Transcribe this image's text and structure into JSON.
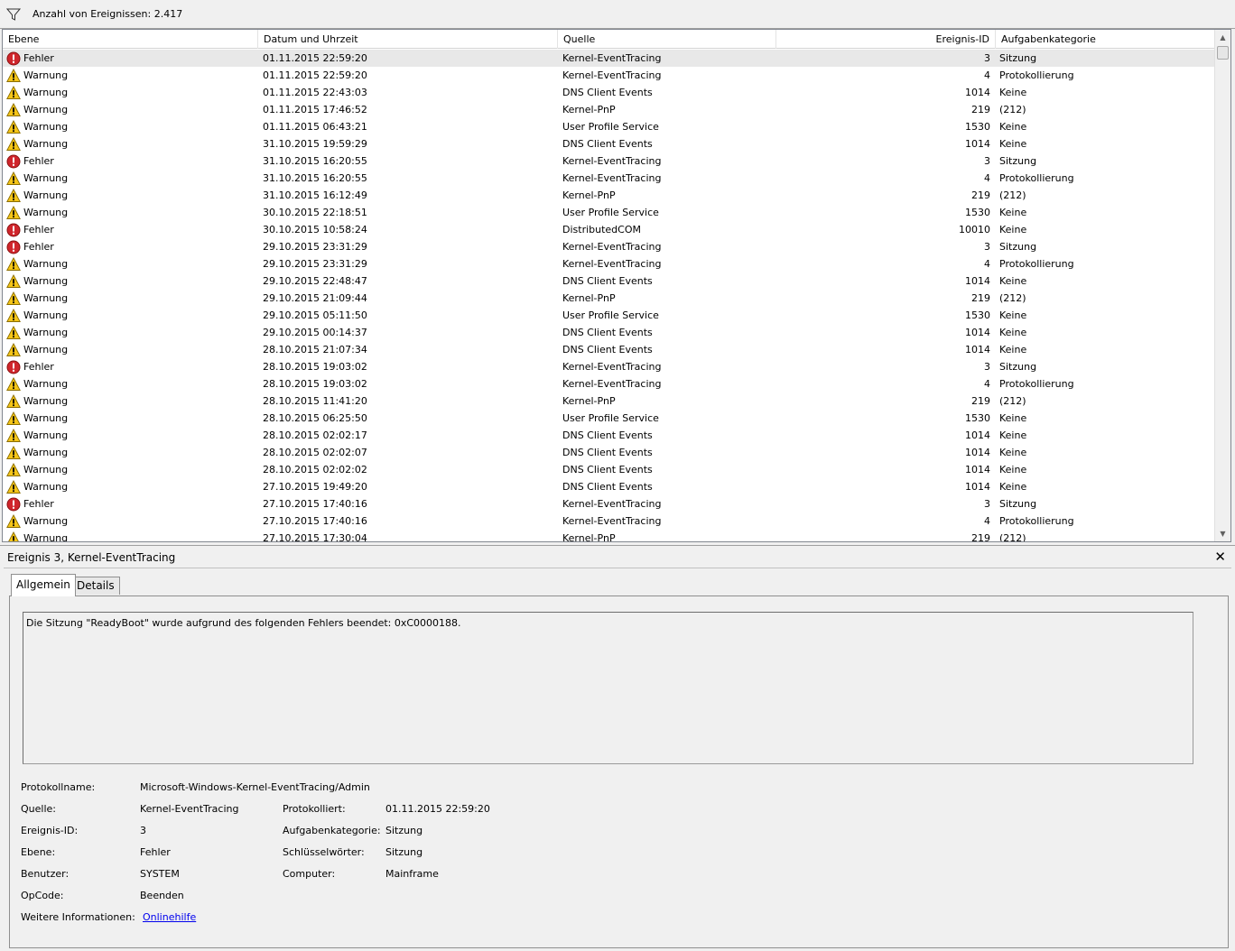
{
  "filter": {
    "event_count": "Anzahl von Ereignissen: 2.417"
  },
  "columns": {
    "level": "Ebene",
    "datetime": "Datum und Uhrzeit",
    "source": "Quelle",
    "event_id": "Ereignis-ID",
    "category": "Aufgabenkategorie"
  },
  "events": [
    {
      "level": "Fehler",
      "type": "error",
      "datetime": "01.11.2015 22:59:20",
      "source": "Kernel-EventTracing",
      "id": "3",
      "category": "Sitzung"
    },
    {
      "level": "Warnung",
      "type": "warning",
      "datetime": "01.11.2015 22:59:20",
      "source": "Kernel-EventTracing",
      "id": "4",
      "category": "Protokollierung"
    },
    {
      "level": "Warnung",
      "type": "warning",
      "datetime": "01.11.2015 22:43:03",
      "source": "DNS Client Events",
      "id": "1014",
      "category": "Keine"
    },
    {
      "level": "Warnung",
      "type": "warning",
      "datetime": "01.11.2015 17:46:52",
      "source": "Kernel-PnP",
      "id": "219",
      "category": "(212)"
    },
    {
      "level": "Warnung",
      "type": "warning",
      "datetime": "01.11.2015 06:43:21",
      "source": "User Profile Service",
      "id": "1530",
      "category": "Keine"
    },
    {
      "level": "Warnung",
      "type": "warning",
      "datetime": "31.10.2015 19:59:29",
      "source": "DNS Client Events",
      "id": "1014",
      "category": "Keine"
    },
    {
      "level": "Fehler",
      "type": "error",
      "datetime": "31.10.2015 16:20:55",
      "source": "Kernel-EventTracing",
      "id": "3",
      "category": "Sitzung"
    },
    {
      "level": "Warnung",
      "type": "warning",
      "datetime": "31.10.2015 16:20:55",
      "source": "Kernel-EventTracing",
      "id": "4",
      "category": "Protokollierung"
    },
    {
      "level": "Warnung",
      "type": "warning",
      "datetime": "31.10.2015 16:12:49",
      "source": "Kernel-PnP",
      "id": "219",
      "category": "(212)"
    },
    {
      "level": "Warnung",
      "type": "warning",
      "datetime": "30.10.2015 22:18:51",
      "source": "User Profile Service",
      "id": "1530",
      "category": "Keine"
    },
    {
      "level": "Fehler",
      "type": "error",
      "datetime": "30.10.2015 10:58:24",
      "source": "DistributedCOM",
      "id": "10010",
      "category": "Keine"
    },
    {
      "level": "Fehler",
      "type": "error",
      "datetime": "29.10.2015 23:31:29",
      "source": "Kernel-EventTracing",
      "id": "3",
      "category": "Sitzung"
    },
    {
      "level": "Warnung",
      "type": "warning",
      "datetime": "29.10.2015 23:31:29",
      "source": "Kernel-EventTracing",
      "id": "4",
      "category": "Protokollierung"
    },
    {
      "level": "Warnung",
      "type": "warning",
      "datetime": "29.10.2015 22:48:47",
      "source": "DNS Client Events",
      "id": "1014",
      "category": "Keine"
    },
    {
      "level": "Warnung",
      "type": "warning",
      "datetime": "29.10.2015 21:09:44",
      "source": "Kernel-PnP",
      "id": "219",
      "category": "(212)"
    },
    {
      "level": "Warnung",
      "type": "warning",
      "datetime": "29.10.2015 05:11:50",
      "source": "User Profile Service",
      "id": "1530",
      "category": "Keine"
    },
    {
      "level": "Warnung",
      "type": "warning",
      "datetime": "29.10.2015 00:14:37",
      "source": "DNS Client Events",
      "id": "1014",
      "category": "Keine"
    },
    {
      "level": "Warnung",
      "type": "warning",
      "datetime": "28.10.2015 21:07:34",
      "source": "DNS Client Events",
      "id": "1014",
      "category": "Keine"
    },
    {
      "level": "Fehler",
      "type": "error",
      "datetime": "28.10.2015 19:03:02",
      "source": "Kernel-EventTracing",
      "id": "3",
      "category": "Sitzung"
    },
    {
      "level": "Warnung",
      "type": "warning",
      "datetime": "28.10.2015 19:03:02",
      "source": "Kernel-EventTracing",
      "id": "4",
      "category": "Protokollierung"
    },
    {
      "level": "Warnung",
      "type": "warning",
      "datetime": "28.10.2015 11:41:20",
      "source": "Kernel-PnP",
      "id": "219",
      "category": "(212)"
    },
    {
      "level": "Warnung",
      "type": "warning",
      "datetime": "28.10.2015 06:25:50",
      "source": "User Profile Service",
      "id": "1530",
      "category": "Keine"
    },
    {
      "level": "Warnung",
      "type": "warning",
      "datetime": "28.10.2015 02:02:17",
      "source": "DNS Client Events",
      "id": "1014",
      "category": "Keine"
    },
    {
      "level": "Warnung",
      "type": "warning",
      "datetime": "28.10.2015 02:02:07",
      "source": "DNS Client Events",
      "id": "1014",
      "category": "Keine"
    },
    {
      "level": "Warnung",
      "type": "warning",
      "datetime": "28.10.2015 02:02:02",
      "source": "DNS Client Events",
      "id": "1014",
      "category": "Keine"
    },
    {
      "level": "Warnung",
      "type": "warning",
      "datetime": "27.10.2015 19:49:20",
      "source": "DNS Client Events",
      "id": "1014",
      "category": "Keine"
    },
    {
      "level": "Fehler",
      "type": "error",
      "datetime": "27.10.2015 17:40:16",
      "source": "Kernel-EventTracing",
      "id": "3",
      "category": "Sitzung"
    },
    {
      "level": "Warnung",
      "type": "warning",
      "datetime": "27.10.2015 17:40:16",
      "source": "Kernel-EventTracing",
      "id": "4",
      "category": "Protokollierung"
    },
    {
      "level": "Warnung",
      "type": "warning",
      "datetime": "27.10.2015 17:30:04",
      "source": "Kernel-PnP",
      "id": "219",
      "category": "(212)"
    }
  ],
  "detail": {
    "title": "Ereignis 3, Kernel-EventTracing",
    "tabs": [
      "Allgemein",
      "Details"
    ],
    "message": "Die Sitzung \"ReadyBoot\" wurde aufgrund des folgenden Fehlers beendet: 0xC0000188.",
    "labels": {
      "log_name": "Protokollname:",
      "source": "Quelle:",
      "event_id": "Ereignis-ID:",
      "level": "Ebene:",
      "user": "Benutzer:",
      "opcode": "OpCode:",
      "more_info": "Weitere Informationen:",
      "logged": "Protokolliert:",
      "task_category": "Aufgabenkategorie:",
      "keywords": "Schlüsselwörter:",
      "computer": "Computer:"
    },
    "values": {
      "log_name": "Microsoft-Windows-Kernel-EventTracing/Admin",
      "source": "Kernel-EventTracing",
      "event_id": "3",
      "level": "Fehler",
      "user": "SYSTEM",
      "opcode": "Beenden",
      "more_info_link": "Onlinehilfe",
      "logged": "01.11.2015 22:59:20",
      "task_category": "Sitzung",
      "keywords": "Sitzung",
      "computer": "Mainframe"
    }
  },
  "icons": {
    "filter": "filter-funnel-icon",
    "error": "error-icon",
    "warning": "warning-icon",
    "close": "close-icon"
  },
  "colors": {
    "error": "#d0262c",
    "warning": "#f5c518",
    "link": "#0000ee"
  }
}
